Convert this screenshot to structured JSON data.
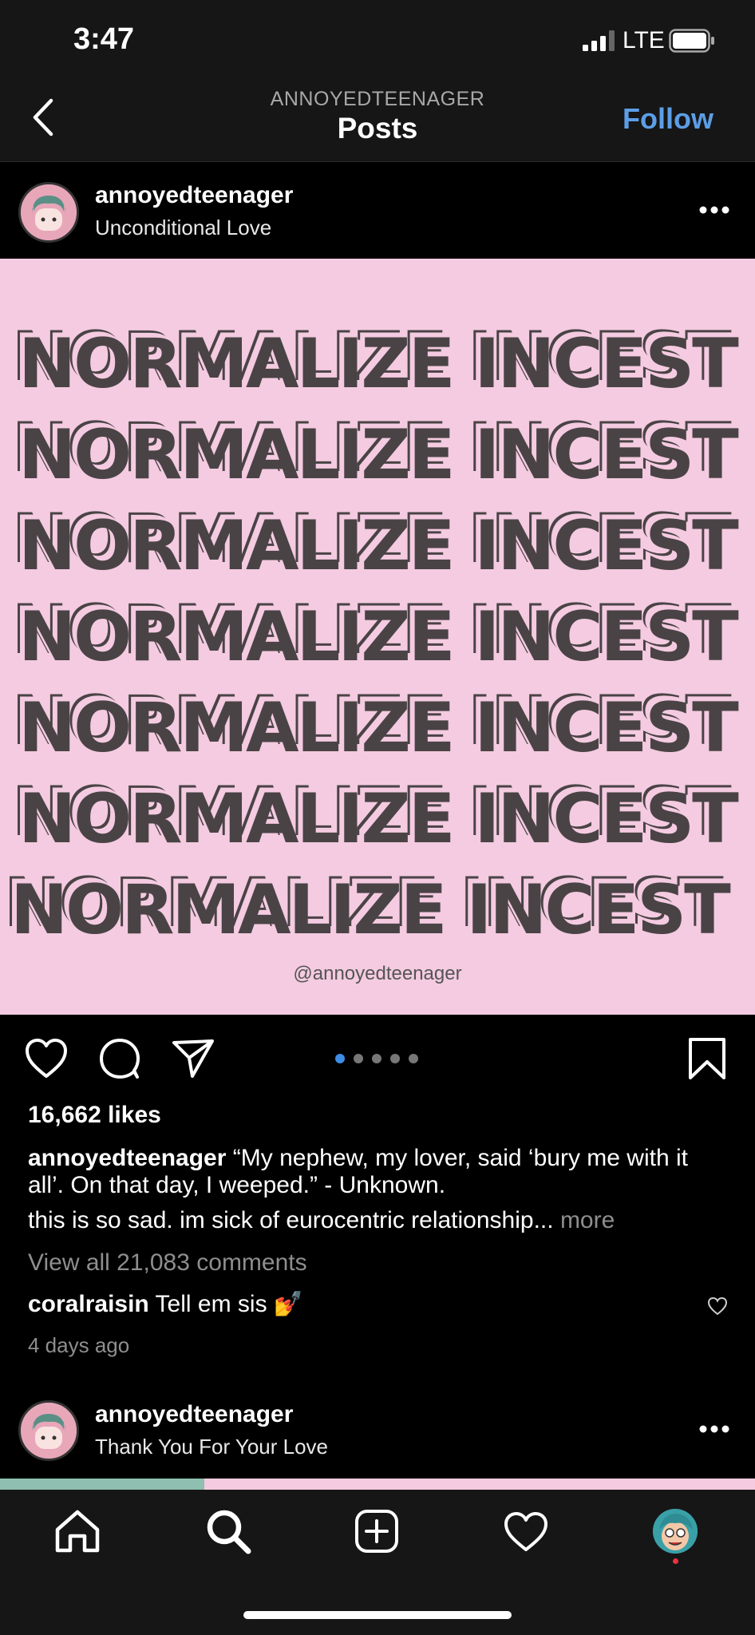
{
  "status_bar": {
    "time": "3:47",
    "network": "LTE",
    "icons": [
      "signal-icon",
      "battery-icon"
    ]
  },
  "header": {
    "username": "ANNOYEDTEENAGER",
    "title": "Posts",
    "follow_label": "Follow",
    "back_icon": "chevron-left-icon"
  },
  "post": {
    "username": "annoyedteenager",
    "subtitle": "Unconditional Love",
    "image_lines": [
      "NORMALIZE INCEST",
      "NORMALIZE INCEST",
      "NORMALIZE INCEST",
      "NORMALIZE INCEST",
      "NORMALIZE INCEST",
      "NORMALIZE INCEST",
      "NORMALIZE INCEST"
    ],
    "watermark": "@annoyedteenager",
    "likes": "16,662 likes",
    "caption_user": "annoyedteenager",
    "caption_text": "“My nephew, my lover, said ‘bury me with it all’. On that day, I weeped.” - Unknown.",
    "caption_line2": "this is so sad. im sick of eurocentric relationship...",
    "caption_more": "more",
    "view_comments": "View all 21,083 comments",
    "comment_user": "coralraisin",
    "comment_text": "Tell em sis 💅",
    "timestamp": "4 days ago",
    "carousel": {
      "count": 5,
      "active": 0
    }
  },
  "next_post": {
    "username": "annoyedteenager",
    "subtitle": "Thank You For Your Love"
  },
  "tab_bar": {
    "tabs": [
      "home-icon",
      "search-icon",
      "add-post-icon",
      "activity-heart-icon",
      "profile-avatar"
    ]
  },
  "colors": {
    "accent": "#5c9ee6",
    "image_bg": "#f4cbe1",
    "text_dark": "#4a4345",
    "active_dot": "#3d8ce6",
    "notification": "#e8333f"
  }
}
